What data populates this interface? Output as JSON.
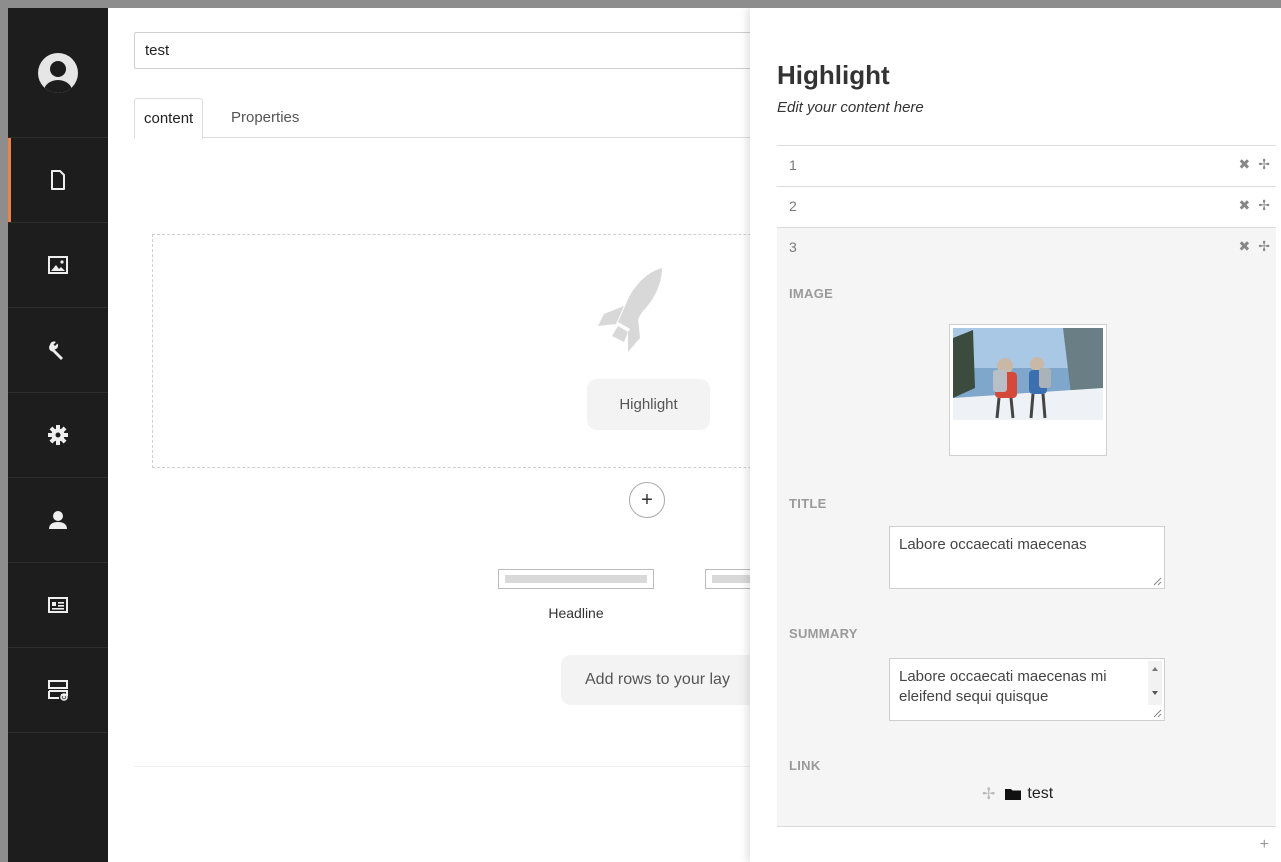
{
  "editor": {
    "name_value": "test",
    "tabs": [
      {
        "label": "content"
      },
      {
        "label": "Properties"
      }
    ],
    "highlight_label": "Highlight",
    "add_label": "+",
    "layout_headline_label": "Headline",
    "add_rows_label": "Add rows to your lay"
  },
  "sidebar": {
    "items": [
      {
        "icon": "document-icon"
      },
      {
        "icon": "image-icon"
      },
      {
        "icon": "wrench-icon"
      },
      {
        "icon": "gear-icon"
      },
      {
        "icon": "user-icon"
      },
      {
        "icon": "id-card-icon"
      },
      {
        "icon": "forms-icon"
      }
    ],
    "accent_color": "#e48550"
  },
  "panel": {
    "title": "Highlight",
    "subtitle": "Edit your content here",
    "rows": [
      {
        "label": "1"
      },
      {
        "label": "2"
      },
      {
        "label": "3"
      }
    ],
    "row_remove_glyph": "✖",
    "row_move_glyph": "✢",
    "fields": {
      "image_label": "IMAGE",
      "title_label": "TITLE",
      "title_value": "Labore occaecati maecenas",
      "summary_label": "SUMMARY",
      "summary_value": "Labore occaecati maecenas mi eleifend sequi quisque",
      "link_label": "LINK",
      "link_value": "test"
    },
    "add_item_glyph": "+"
  }
}
